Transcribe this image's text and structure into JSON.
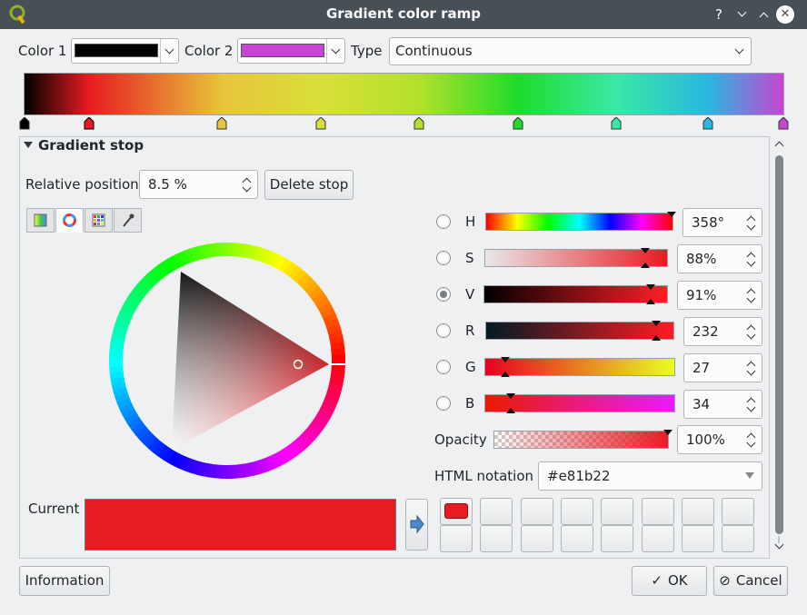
{
  "window": {
    "title": "Gradient color ramp",
    "help_glyph": "?",
    "minimize_glyph": "﹀",
    "maximize_glyph": "︿",
    "close_glyph": "✕"
  },
  "top": {
    "color1_label": "Color 1",
    "color1_value": "#000000",
    "color2_label": "Color 2",
    "color2_value": "#c844d4",
    "type_label": "Type",
    "type_value": "Continuous"
  },
  "gradient": {
    "stops": [
      {
        "pos": 0.0,
        "color": "#000000"
      },
      {
        "pos": 0.085,
        "color": "#e81b22"
      },
      {
        "pos": 0.26,
        "color": "#e8c43a"
      },
      {
        "pos": 0.39,
        "color": "#d8e03a"
      },
      {
        "pos": 0.52,
        "color": "#b4e02a"
      },
      {
        "pos": 0.65,
        "color": "#1fdc2a"
      },
      {
        "pos": 0.78,
        "color": "#3ae8a6"
      },
      {
        "pos": 0.9,
        "color": "#2ab8e0"
      },
      {
        "pos": 1.0,
        "color": "#c844d4"
      }
    ]
  },
  "gradient_stop_section": {
    "header": "Gradient stop",
    "relative_position_label": "Relative position",
    "relative_position_value": "8.5 %",
    "delete_stop_label": "Delete stop"
  },
  "picker_tabs": [
    "ramp-icon",
    "wheel-icon",
    "palette-icon",
    "eyedropper-icon"
  ],
  "channels": [
    {
      "key": "H",
      "label": "H",
      "value": "358°",
      "selected": false,
      "level": 0.994
    },
    {
      "key": "S",
      "label": "S",
      "value": "88%",
      "selected": false,
      "level": 0.88
    },
    {
      "key": "V",
      "label": "V",
      "value": "91%",
      "selected": true,
      "level": 0.91
    },
    {
      "key": "R",
      "label": "R",
      "value": "232",
      "selected": false,
      "level": 0.91
    },
    {
      "key": "G",
      "label": "G",
      "value": "27",
      "selected": false,
      "level": 0.106
    },
    {
      "key": "B",
      "label": "B",
      "value": "34",
      "selected": false,
      "level": 0.133
    }
  ],
  "opacity": {
    "label": "Opacity",
    "value": "100%",
    "level": 1.0
  },
  "html_notation": {
    "label": "HTML notation",
    "value": "#e81b22"
  },
  "current": {
    "label": "Current",
    "color": "#e81b22"
  },
  "swatch_cells": [
    {
      "color": "#e81b22"
    },
    {
      "color": ""
    },
    {
      "color": ""
    },
    {
      "color": ""
    },
    {
      "color": ""
    },
    {
      "color": ""
    },
    {
      "color": ""
    },
    {
      "color": ""
    },
    {
      "color": ""
    },
    {
      "color": ""
    },
    {
      "color": ""
    },
    {
      "color": ""
    },
    {
      "color": ""
    },
    {
      "color": ""
    },
    {
      "color": ""
    },
    {
      "color": ""
    }
  ],
  "buttons": {
    "information": "Information",
    "ok": "OK",
    "cancel": "Cancel",
    "ok_glyph": "✓",
    "cancel_glyph": "⊘"
  }
}
